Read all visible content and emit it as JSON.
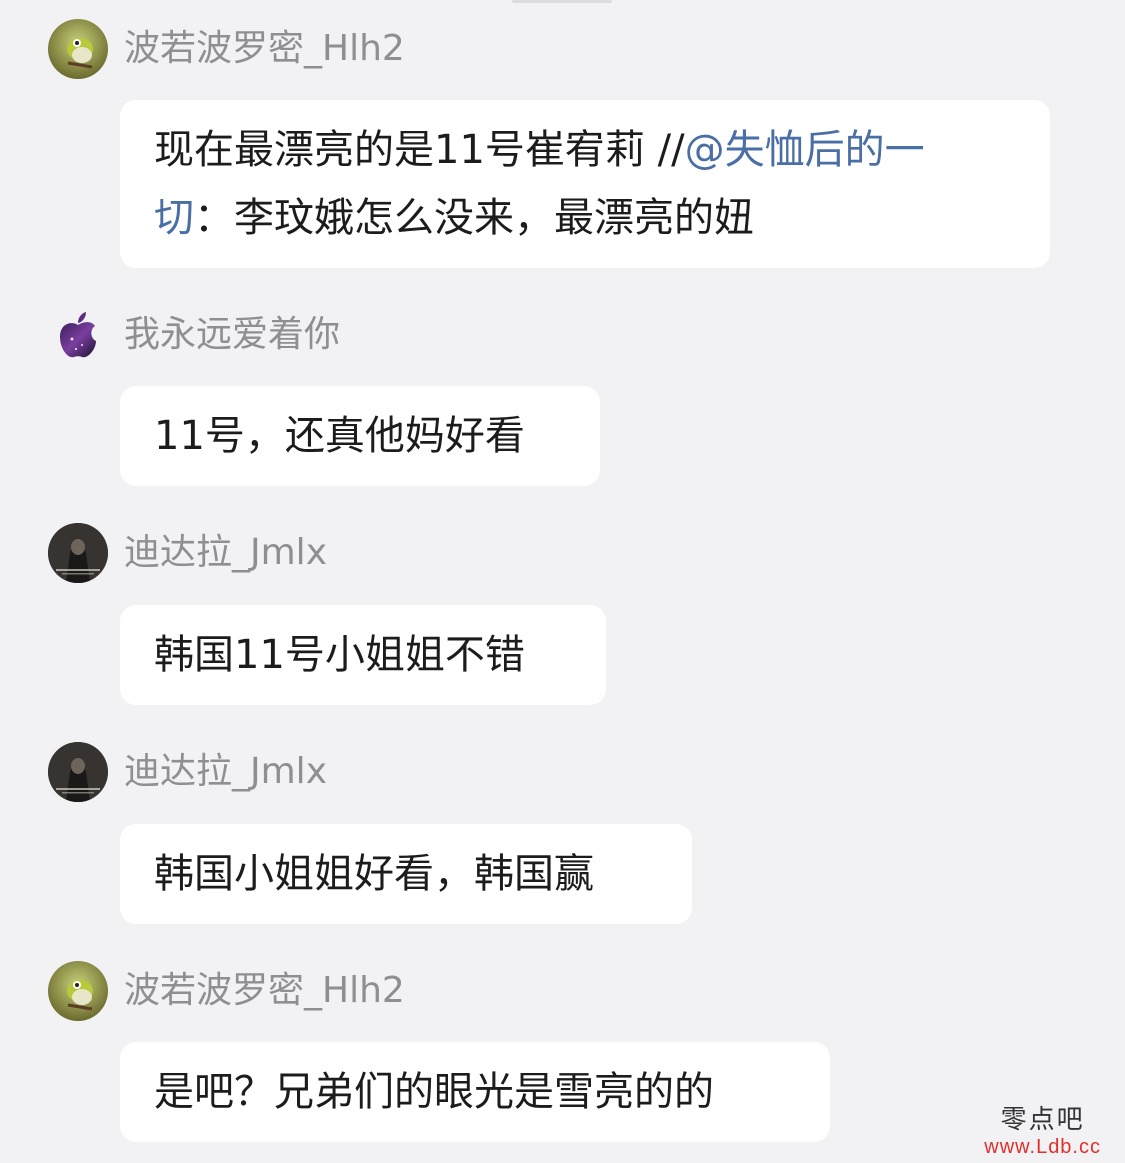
{
  "comments": [
    {
      "username": "波若波罗密_Hlh2",
      "avatar_icon": "bird-avatar-icon",
      "text_line1_part1": "现在最漂亮的是11号崔宥莉 //",
      "mention": "@失恤后的一",
      "mention_cont": "切",
      "text_line2_rest": "：李玟娥怎么没来，最漂亮的妞"
    },
    {
      "username": "我永远爱着你",
      "avatar_icon": "apple-logo-avatar-icon",
      "text": "11号，还真他妈好看"
    },
    {
      "username": "迪达拉_Jmlx",
      "avatar_icon": "dark-portrait-avatar-icon",
      "text": "韩国11号小姐姐不错"
    },
    {
      "username": "迪达拉_Jmlx",
      "avatar_icon": "dark-portrait-avatar-icon",
      "text": "韩国小姐姐好看，韩国赢"
    },
    {
      "username": "波若波罗密_Hlh2",
      "avatar_icon": "bird-avatar-icon",
      "text": "是吧？兄弟们的眼光是雪亮的的"
    }
  ],
  "watermark": {
    "name": "零点吧",
    "url": "www.Ldb.cc"
  },
  "colors": {
    "background": "#f2f2f4",
    "bubble": "#ffffff",
    "username": "#8e8e93",
    "mention": "#4a6fa5",
    "watermark_url": "#e0302a"
  }
}
